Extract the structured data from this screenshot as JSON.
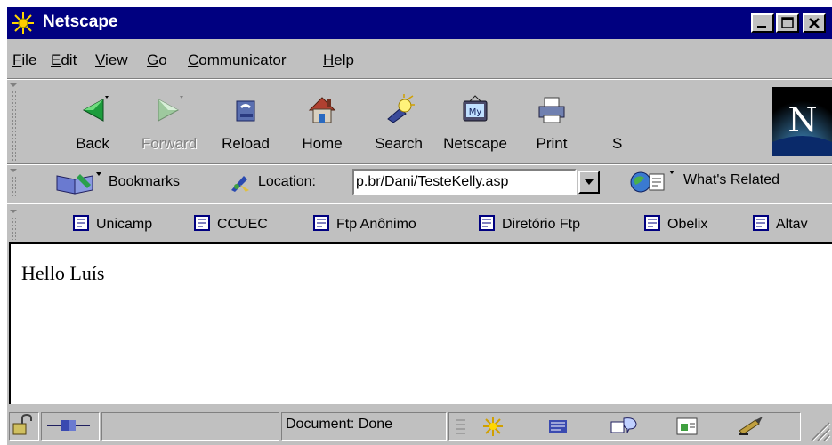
{
  "window": {
    "title": "Netscape"
  },
  "menu": [
    "File",
    "Edit",
    "View",
    "Go",
    "Communicator",
    "Help"
  ],
  "menu_mnemonics": [
    "F",
    "E",
    "V",
    "G",
    "C",
    "H"
  ],
  "nav_toolbar": {
    "back": "Back",
    "forward": "Forward",
    "reload": "Reload",
    "home": "Home",
    "search": "Search",
    "netscape": "Netscape",
    "print": "Print",
    "security_partial": "S"
  },
  "location_bar": {
    "bookmarks": "Bookmarks",
    "location_label": "Location:",
    "url": "p.br/Dani/TesteKelly.asp",
    "whats_related": "What's Related"
  },
  "personal_toolbar": [
    "Unicamp",
    "CCUEC",
    "Ftp Anônimo",
    "Diretório Ftp",
    "Obelix",
    "Altav"
  ],
  "page": {
    "body_text": "Hello Luís"
  },
  "status": {
    "text": "Document: Done"
  },
  "colors": {
    "titlebar": "#000080",
    "chrome": "#c0c0c0",
    "content": "#ffffff"
  }
}
